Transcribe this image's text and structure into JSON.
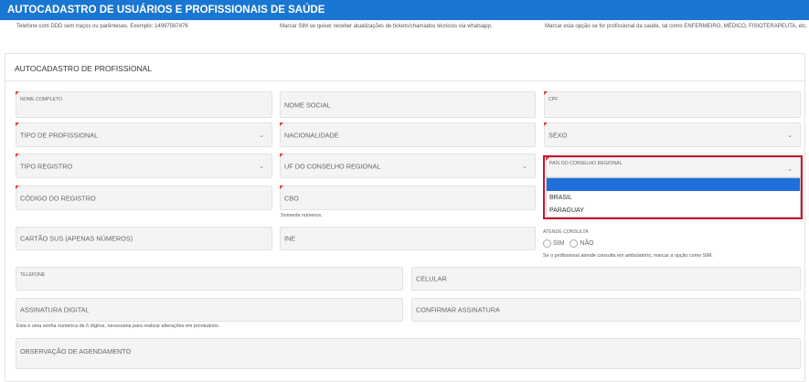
{
  "header": {
    "title": "AUTOCADASTRO DE USUÁRIOS E PROFISSIONAIS DE SAÚDE"
  },
  "hints": [
    "Telefone com DDD sem traços ou parênteses. Exemplo: 14997567476",
    "Marcar SIM se quiser receber atualizações de tickets/chamados técnicos via whatsapp.",
    "Marcar esta opção se for profissional da saúde, tal como ENFERMEIRO, MÉDICO, FISIOTERAPEUTA, etc."
  ],
  "section": {
    "title": "AUTOCADASTRO DE PROFISSIONAL"
  },
  "fields": {
    "nome_completo": "NOME COMPLETO",
    "nome_social": "NOME SOCIAL",
    "cpf": "CPF",
    "tipo_profissional": "TIPO DE PROFISSIONAL",
    "nacionalidade": "NACIONALIDADE",
    "sexo": "SEXO",
    "tipo_registro": "TIPO REGISTRO",
    "uf_conselho": "UF DO CONSELHO REGIONAL",
    "pais_conselho": "PAÍS DO CONSELHO REGIONAL",
    "codigo_registro": "CÓDIGO DO REGISTRO",
    "cbo": "CBO",
    "cartao_sus": "CARTÃO SUS (APENAS NÚMEROS)",
    "ine": "INE",
    "telefone": "TELEFONE",
    "celular": "CELULAR",
    "assinatura": "ASSINATURA DIGITAL",
    "confirmar_assinatura": "CONFIRMAR ASSINATURA",
    "observacao": "OBSERVAÇÃO DE AGENDAMENTO"
  },
  "dropdown": {
    "options": [
      "",
      "BRASIL",
      "PARAGUAY"
    ]
  },
  "notes": {
    "cbo": "Somente números.",
    "atende": "Se o profissional atende consulta em ambulatório, marcar a opção como SIM.",
    "assinatura": "Esta é uma senha numérica de 6 dígitos, necessária para realizar alterações em prontuários."
  },
  "atende_consulta": {
    "title": "ATENDE CONSULTA",
    "sim": "SIM",
    "nao": "NÃO"
  }
}
